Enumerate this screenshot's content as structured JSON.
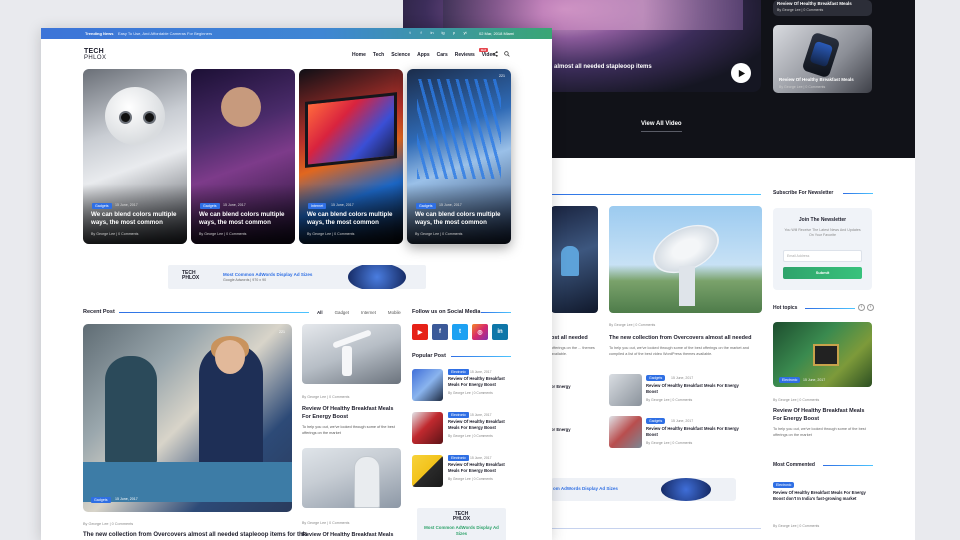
{
  "back": {
    "video_title": "s almost all needed stapleoop items",
    "side_videos": [
      {
        "title": "Review Of Healthy Breakfast Meals",
        "meta": "By George Lee  |  0 Comments"
      },
      {
        "title": "Review Of Healthy Breakfast Meals",
        "meta": "By George Lee  |  0 Comments"
      }
    ],
    "view_all": "View All Video",
    "newsletter_title": "Subscribe For Newsletter",
    "newsletter_box": {
      "title": "Join The Newsletter",
      "text": "You Will Receive The Latest News And Updates On Your Favorite",
      "email_placeholder": "Email Address",
      "button": "Submit"
    },
    "hot_topics": "Hot topics",
    "hot_tag": "Electronic",
    "hot_date": "15 June, 2017",
    "hot_meta": "By George Lee  |  0 Comments",
    "hot_title": "Review Of Healthy Breakfast Meals For Energy Boost",
    "hot_text": "To help you out, we've looked through some of the best offerings on the market",
    "most_commented": "Most Commented",
    "mc_tag": "Electronic",
    "mc_title": "Review Of Healthy Breakfast Meals For Energy Boost don't In India's fast-growing market",
    "mc_meta": "By George Lee  |  0 Comments",
    "mid_meta": "By George Lee  |  0 Comments",
    "mid_title": "The new collection from Overcovers almost all needed",
    "mid_text": "To help you out, we've looked through some of the best offerings on the market and compiled a list of the best video WordPress themes available.",
    "left_title_partial": "ost all needed",
    "left_text_partial": "offerings on the ... themes available.",
    "list_items": [
      {
        "tag": "Gadgets",
        "date": "15 June, 2017",
        "title": "Review Of Healthy Breakfast Meals For Energy Boost",
        "meta": "By George Lee  |  0 Comments"
      },
      {
        "tag": "Gadgets",
        "date": "15 June, 2017",
        "title": "Review Of Healthy Breakfast Meals For Energy Boost",
        "meta": "By George Lee  |  0 Comments"
      }
    ],
    "partial_for_energy_1": "or Energy",
    "partial_for_energy_2": "or Energy",
    "banner2_text": "om AdWords Display Ad Sizes"
  },
  "topbar": {
    "label": "Trending News",
    "text": "Easy To Use, And Affordable Cameras For Beginners",
    "date": "02 Mar, 2018 Miami",
    "socials": [
      "t",
      "f",
      "in",
      "ig",
      "p",
      "yt"
    ]
  },
  "logo": {
    "line1": "TECH",
    "line2": "PHLOX"
  },
  "nav": {
    "items": [
      "Home",
      "Tech",
      "Science",
      "Apps",
      "Cars",
      "Reviews",
      "Video"
    ],
    "hot_badge": "Hot"
  },
  "heroes": [
    {
      "tag": "Gadgets",
      "date": "15 June, 2017",
      "title": "We can blend colors multiple ways, the most common",
      "meta": "By George Lee  |  0 Comments"
    },
    {
      "tag": "Gadgets",
      "date": "15 June, 2017",
      "title": "We can blend colors multiple ways, the most common",
      "meta": "By George Lee  |  0 Comments"
    },
    {
      "tag": "Internet",
      "date": "15 June, 2017",
      "title": "We can blend colors multiple ways, the most common",
      "meta": "By George Lee  |  0 Comments"
    },
    {
      "tag": "Gadgets",
      "date": "15 June, 2017",
      "title": "We can blend colors multiple ways, the most common",
      "meta": "By George Lee  |  0 Comments",
      "views": "221"
    }
  ],
  "ad_banner": {
    "logo1": "TECH",
    "logo2": "PHLOX",
    "title": "Most Common AdWords Display Ad Sizes",
    "sub": "Google Adwords  |  970 x 90"
  },
  "recent": {
    "title": "Recent Post",
    "filters": [
      "All",
      "Gadget",
      "Internet",
      "Mobile"
    ],
    "big": {
      "tag": "Gadgets",
      "date": "15 June, 2017",
      "views": "221",
      "meta": "By George Lee  |  0 Comments",
      "title": "The new collection from Overcovers almost all needed stapleoop items for this"
    },
    "small1": {
      "meta": "By George Lee  |  0 Comments",
      "title": "Review Of Healthy Breakfast Meals For Energy Boost",
      "text": "To help you out, we've looked through some of the best offerings on the market"
    },
    "small2": {
      "meta": "By George Lee  |  0 Comments",
      "title": "Review Of Healthy Breakfast Meals"
    }
  },
  "social": {
    "title": "Follow us on Social Media",
    "icons": [
      "▶",
      "f",
      "t",
      "◎",
      "in"
    ],
    "colors": [
      "#e62117",
      "#3b5998",
      "#1da1f2",
      "#d6296b",
      "#0e76a8"
    ]
  },
  "popular": {
    "title": "Popular Post",
    "items": [
      {
        "tag": "Electronic",
        "date": "15 June, 2017",
        "title": "Review Of Healthy Breakfast Meals For Energy Boost",
        "meta": "By George Lee  |  0 Comments"
      },
      {
        "tag": "Electronic",
        "date": "15 June, 2017",
        "title": "Review Of Healthy Breakfast Meals For Energy Boost",
        "meta": "By George Lee  |  0 Comments"
      },
      {
        "tag": "Electronic",
        "date": "15 June, 2017",
        "title": "Review Of Healthy Breakfast Meals For Energy Boost",
        "meta": "By George Lee  |  0 Comments"
      }
    ]
  },
  "side_ad": {
    "logo1": "TECH",
    "logo2": "PHLOX",
    "text": "Most Common AdWords Display Ad Sizes"
  },
  "colors": {
    "accent": "#2f6fe4",
    "green": "#2fa36b",
    "dark": "#111218"
  }
}
